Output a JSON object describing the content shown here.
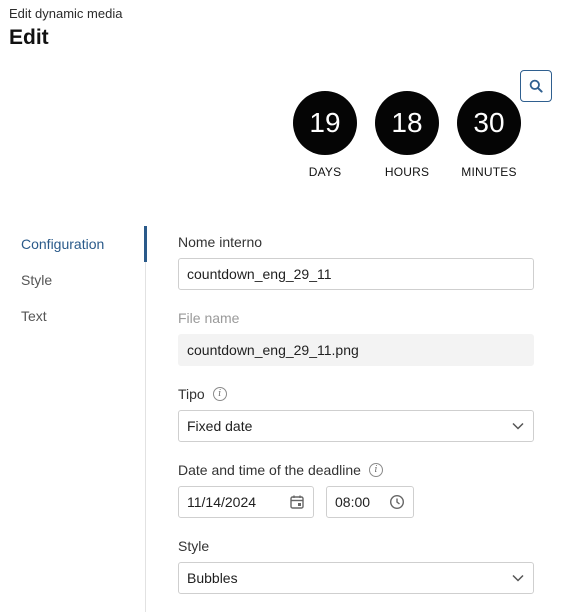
{
  "header": {
    "breadcrumb": "Edit dynamic media",
    "title": "Edit"
  },
  "preview": {
    "icon": "search-icon"
  },
  "countdown": {
    "units": [
      {
        "value": "19",
        "label": "DAYS"
      },
      {
        "value": "18",
        "label": "HOURS"
      },
      {
        "value": "30",
        "label": "MINUTES"
      }
    ]
  },
  "sidebar": {
    "items": [
      {
        "label": "Configuration",
        "active": true
      },
      {
        "label": "Style",
        "active": false
      },
      {
        "label": "Text",
        "active": false
      }
    ]
  },
  "form": {
    "internal_name": {
      "label": "Nome interno",
      "value": "countdown_eng_29_11"
    },
    "file_name": {
      "label": "File name",
      "value": "countdown_eng_29_11.png"
    },
    "type": {
      "label": "Tipo",
      "value": "Fixed date"
    },
    "deadline": {
      "label": "Date and time of the deadline",
      "date": "11/14/2024",
      "time": "08:00"
    },
    "style": {
      "label": "Style",
      "value": "Bubbles"
    }
  },
  "colors": {
    "accent": "#2a5a8a",
    "bubble": "#050505"
  }
}
